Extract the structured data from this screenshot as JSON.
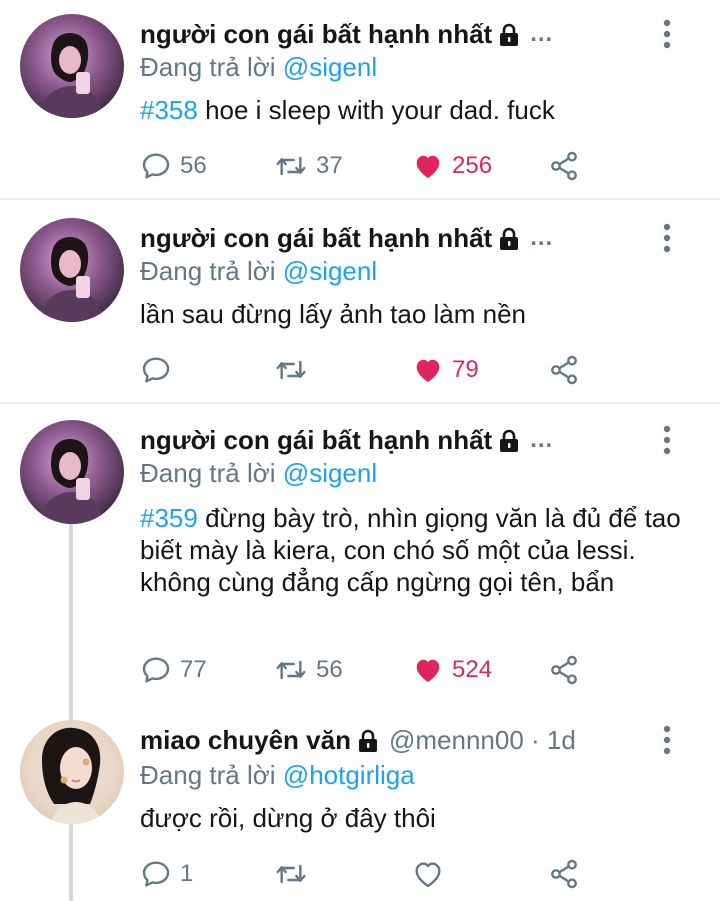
{
  "tweets": [
    {
      "display_name": "người con gái bất hạnh nhất",
      "ellipsis": "...",
      "handle": "",
      "reply_prefix": "Đang trả lời",
      "reply_to": "@sigenl",
      "hashtag": "#358",
      "text": " hoe i sleep with your dad. fuck",
      "reply_count": "56",
      "retweet_count": "37",
      "like_count": "256",
      "liked": true
    },
    {
      "display_name": "người con gái bất hạnh nhất",
      "ellipsis": "...",
      "handle": "",
      "reply_prefix": "Đang trả lời",
      "reply_to": "@sigenl",
      "hashtag": "",
      "text": "lần sau đừng lấy ảnh tao làm nền",
      "reply_count": "",
      "retweet_count": "",
      "like_count": "79",
      "liked": true
    },
    {
      "display_name": "người con gái bất hạnh nhất",
      "ellipsis": "...",
      "handle": "",
      "reply_prefix": "Đang trả lời",
      "reply_to": "@sigenl",
      "hashtag": "#359",
      "text": " đừng bày trò, nhìn giọng văn là đủ để tao biết mày là kiera, con chó số một của lessi. không cùng đẳng cấp ngừng gọi tên, bẩn",
      "reply_count": "77",
      "retweet_count": "56",
      "like_count": "524",
      "liked": true
    },
    {
      "display_name": "miao chuyên văn",
      "ellipsis": "",
      "handle": "@mennn00 · 1d",
      "reply_prefix": "Đang trả lời",
      "reply_to": "@hotgirliga",
      "hashtag": "",
      "text": "được rồi, dừng ở đây thôi",
      "reply_count": "1",
      "retweet_count": "",
      "like_count": "",
      "liked": false
    }
  ],
  "icons": {
    "reply": "reply-icon",
    "retweet": "retweet-icon",
    "like": "heart-icon",
    "share": "share-icon",
    "lock": "lock-icon",
    "more": "more-vertical-icon"
  },
  "colors": {
    "link": "#1da1f2",
    "secondary_text": "#657786",
    "like": "#e0245e",
    "divider": "#e6ecf0",
    "thread_line": "#cfd9de"
  }
}
